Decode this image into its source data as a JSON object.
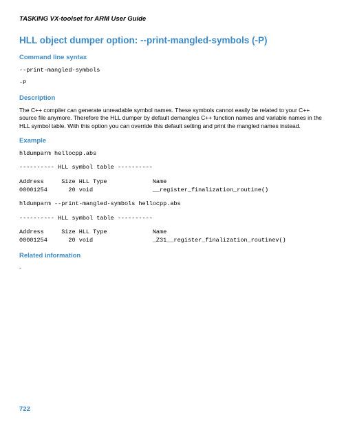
{
  "doc_header": "TASKING VX-toolset for ARM User Guide",
  "title": "HLL object dumper option: --print-mangled-symbols (-P)",
  "sections": {
    "syntax_heading": "Command line syntax",
    "syntax_line1": "--print-mangled-symbols",
    "syntax_line2": "-P",
    "description_heading": "Description",
    "description_text": "The C++ compiler can generate unreadable symbol names. These symbols cannot easily be related to your C++ source file anymore. Therefore the HLL dumper by default demangles C++ function names and variable names in the HLL symbol table. With this option you can override this default setting and print the mangled names instead.",
    "example_heading": "Example",
    "example_block1": "hldumparm hellocpp.abs",
    "example_block2": "---------- HLL symbol table ----------",
    "example_block3a": "Address     Size HLL Type             Name",
    "example_block3b": "00001254      20 void                 __register_finalization_routine()",
    "example_block4": "hldumparm --print-mangled-symbols hellocpp.abs",
    "example_block5": "---------- HLL symbol table ----------",
    "example_block6a": "Address     Size HLL Type             Name",
    "example_block6b": "00001254      20 void                 _Z31__register_finalization_routinev()",
    "related_heading": "Related information",
    "related_text": "-"
  },
  "page_number": "722"
}
